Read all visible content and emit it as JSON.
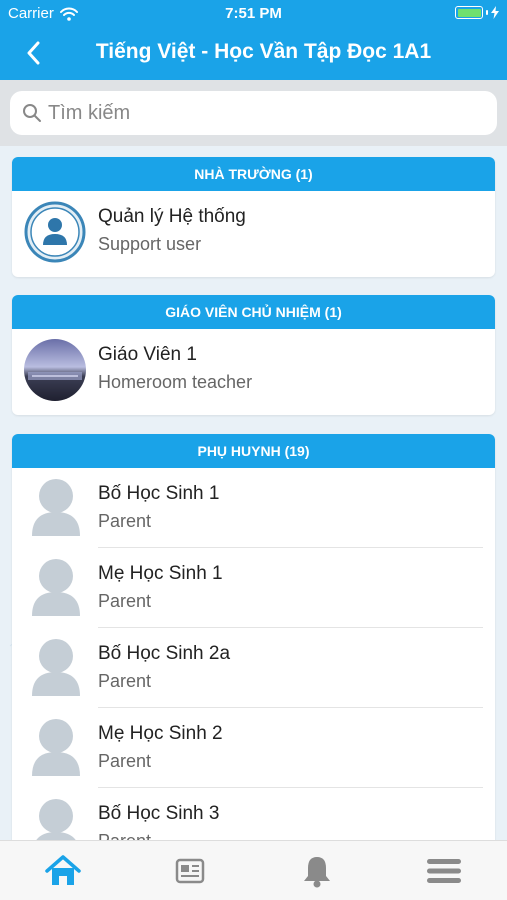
{
  "status": {
    "carrier": "Carrier",
    "time": "7:51 PM"
  },
  "header": {
    "title": "Tiếng Việt - Học Vần Tập Đọc 1A1"
  },
  "search": {
    "placeholder": "Tìm kiếm"
  },
  "sections": {
    "school": {
      "title": "NHÀ TRƯỜNG (1)",
      "items": [
        {
          "name": "Quản lý Hệ thống",
          "role": "Support user"
        }
      ]
    },
    "homeroom": {
      "title": "GIÁO VIÊN CHỦ NHIỆM (1)",
      "items": [
        {
          "name": "Giáo Viên 1",
          "role": "Homeroom teacher"
        }
      ]
    },
    "parents": {
      "title": "PHỤ HUYNH (19)",
      "items": [
        {
          "name": "Bố Học Sinh 1",
          "role": "Parent"
        },
        {
          "name": "Mẹ Học Sinh 1",
          "role": "Parent"
        },
        {
          "name": "Bố Học Sinh 2a",
          "role": "Parent"
        },
        {
          "name": "Mẹ Học Sinh 2",
          "role": "Parent"
        },
        {
          "name": "Bố Học Sinh 3",
          "role": "Parent"
        }
      ]
    }
  },
  "tabs": [
    {
      "icon": "home-icon",
      "active": true
    },
    {
      "icon": "news-icon",
      "active": false
    },
    {
      "icon": "bell-icon",
      "active": false
    },
    {
      "icon": "menu-icon",
      "active": false
    }
  ],
  "colors": {
    "primary": "#1aa3e8",
    "tab_active": "#1aa3e8",
    "tab_inactive": "#8a8a8a",
    "avatar_placeholder": "#c5ced6"
  }
}
